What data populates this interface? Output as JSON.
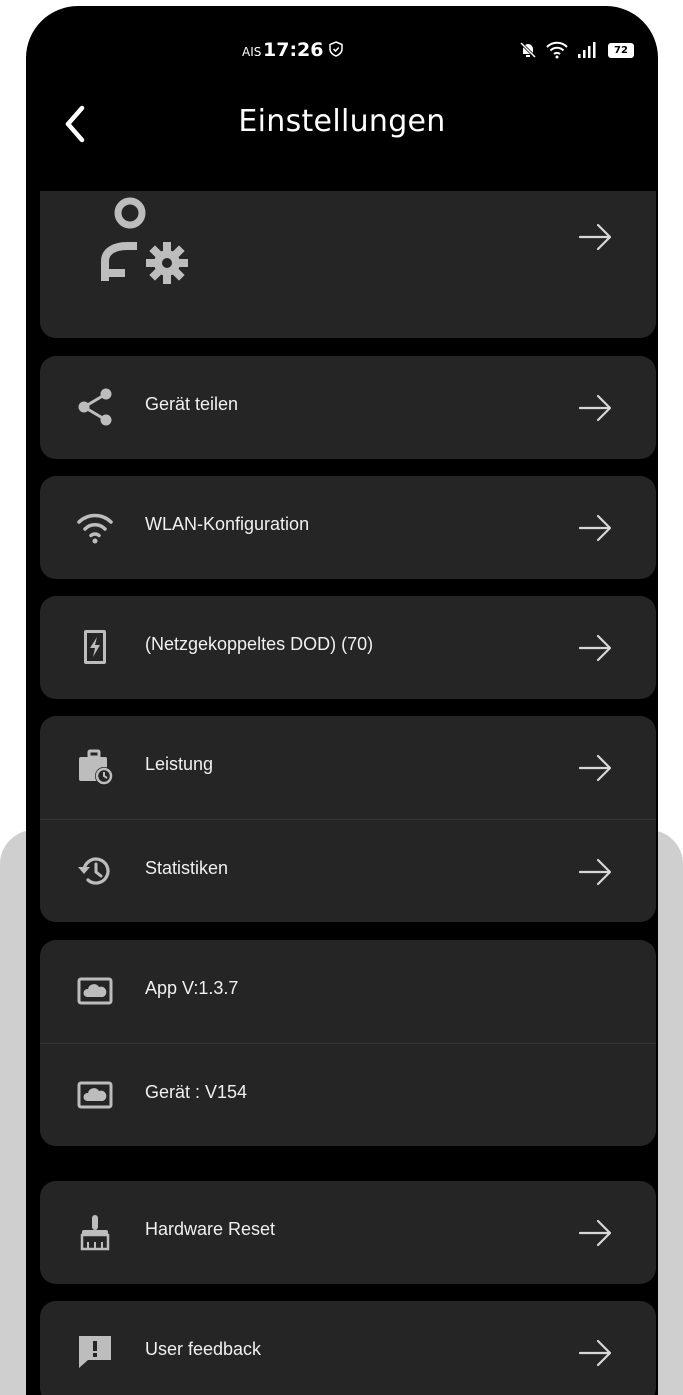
{
  "status_bar": {
    "carrier": "AIS",
    "time": "17:26",
    "battery": "72"
  },
  "header": {
    "title": "Einstellungen"
  },
  "items": [
    {
      "label": "Gerät teilen"
    },
    {
      "label": "WLAN-Konfiguration"
    },
    {
      "label": "(Netzgekoppeltes DOD)  (70)"
    },
    {
      "label": "Leistung"
    },
    {
      "label": "Statistiken"
    },
    {
      "label": "App V:1.3.7"
    },
    {
      "label": "Gerät : V154"
    },
    {
      "label": "Hardware Reset"
    },
    {
      "label": "User feedback"
    }
  ],
  "colors": {
    "background": "#000000",
    "card": "#252525",
    "text": "#f0f0f0",
    "icon": "#bdbdbd"
  },
  "icons": [
    "user-gear-icon",
    "share-icon",
    "wifi-icon",
    "battery-charge-icon",
    "briefcase-clock-icon",
    "history-icon",
    "cloud-icon",
    "broom-icon",
    "feedback-icon",
    "arrow-right-icon"
  ]
}
